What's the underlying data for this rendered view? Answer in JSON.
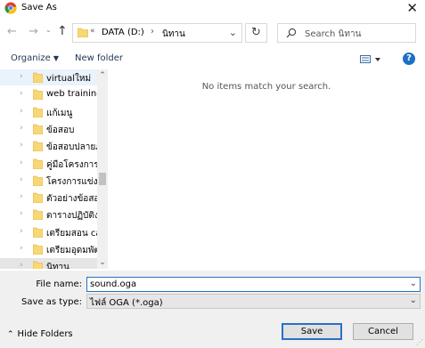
{
  "window": {
    "title": "Save As"
  },
  "nav": {
    "address_chevron": "«",
    "address_segments": [
      "DATA (D:)",
      "นิทาน"
    ],
    "address_separator": "›",
    "search_placeholder": "Search นิทาน"
  },
  "toolbar": {
    "organize_label": "Organize",
    "new_folder_label": "New folder",
    "help_label": "?"
  },
  "tree": {
    "items": [
      {
        "label": "virtualใหม่"
      },
      {
        "label": "web training"
      },
      {
        "label": "แก้เมนู"
      },
      {
        "label": "ข้อสอบ"
      },
      {
        "label": "ข้อสอบปลายภาค"
      },
      {
        "label": "คู่มือโครงการพ"
      },
      {
        "label": "โครงการแข่งขัน"
      },
      {
        "label": "ตัวอย่างข้อสอบ"
      },
      {
        "label": "ตารางปฏิบัติงาน"
      },
      {
        "label": "เตรียมสอน can"
      },
      {
        "label": "เตรียมอุดมพัฒนา"
      },
      {
        "label": "นิทาน"
      }
    ],
    "selected_index": 11,
    "hover_index": 0
  },
  "content": {
    "empty_message": "No items match your search."
  },
  "footer": {
    "file_name_label": "File name:",
    "file_name_value": "sound.oga",
    "save_type_label": "Save as type:",
    "save_type_value": "ไฟล์ OGA (*.oga)",
    "hide_folders_label": "Hide Folders",
    "save_label": "Save",
    "cancel_label": "Cancel"
  },
  "colors": {
    "accent": "#2a70c4",
    "folder": "#f8d775",
    "footer_bg": "#f0f0f0"
  }
}
